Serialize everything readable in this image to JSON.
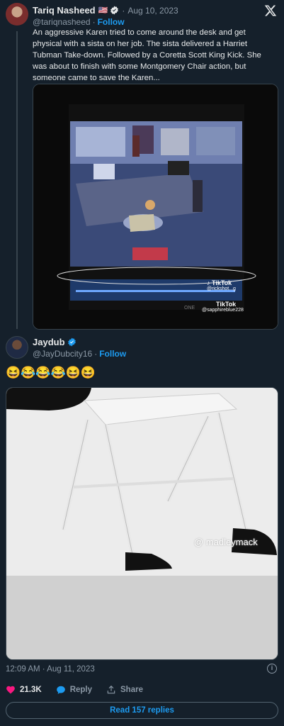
{
  "post1": {
    "display_name": "Tariq Nasheed",
    "flag": "🇺🇸",
    "date": "Aug 10, 2023",
    "handle": "@tariqnasheed",
    "follow_label": "Follow",
    "text": "An aggressive Karen tried to come around the desk and get physical with a sista on her job. The sista delivered a Harriet Tubman Take-down. Followed by a Coretta Scott King Kick. She was about to finish with some Montgomery Chair action, but someone came to save the Karen...",
    "video": {
      "watermark_1": "TikTok",
      "watermark_1_handle": "@rickshot...g",
      "watermark_2": "TikTok",
      "watermark_2_handle": "@sapphireblue228",
      "monitor_brand": "ONE"
    }
  },
  "post2": {
    "display_name": "Jaydub",
    "handle": "@JayDubcity16",
    "follow_label": "Follow",
    "emojis": "😆😂😂😂😆😆",
    "image_watermark": "@ madleymack"
  },
  "footer": {
    "timestamp": "12:09 AM · Aug 11, 2023",
    "likes": "21.3K",
    "reply_label": "Reply",
    "share_label": "Share",
    "read_replies_label": "Read 157 replies"
  },
  "colors": {
    "background": "#15202b",
    "accent": "#1d9bf0",
    "like": "#f91880",
    "muted": "#8b98a5",
    "verified": "#1d9bf0"
  },
  "icons": [
    "x-logo-icon",
    "verified-badge-icon",
    "heart-icon",
    "reply-bubble-icon",
    "share-icon",
    "info-icon",
    "tiktok-icon"
  ]
}
